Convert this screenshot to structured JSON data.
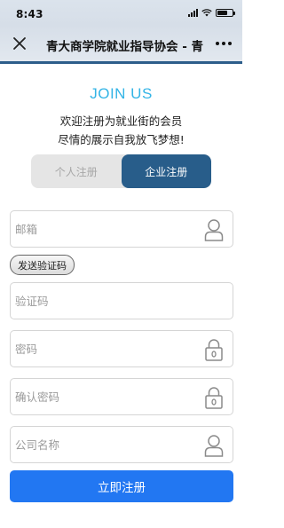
{
  "status_bar": {
    "time": "8:43"
  },
  "nav": {
    "title": "青大商学院就业指导协会 - 青"
  },
  "header": {
    "join_title": "JOIN US",
    "subtitle_line1": "欢迎注册为就业街的会员",
    "subtitle_line2": "尽情的展示自我放飞梦想!"
  },
  "tabs": [
    {
      "label": "个人注册",
      "active": false
    },
    {
      "label": "企业注册",
      "active": true
    }
  ],
  "form": {
    "email_placeholder": "邮箱",
    "send_code_label": "发送验证码",
    "code_placeholder": "验证码",
    "password_placeholder": "密码",
    "confirm_password_placeholder": "确认密码",
    "company_placeholder": "公司名称",
    "submit_label": "立即注册"
  },
  "colors": {
    "accent": "#33b4e6",
    "active_tab": "#285d8a",
    "submit": "#2277f2"
  },
  "icons": {
    "close": "close-icon",
    "more": "more-icon",
    "user": "user-icon",
    "lock": "lock-icon"
  }
}
